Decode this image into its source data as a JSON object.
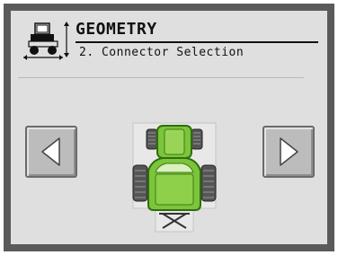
{
  "header": {
    "title": "GEOMETRY",
    "subtitle": "2. Connector Selection",
    "icon": "tractor-geometry-icon"
  },
  "nav": {
    "left_icon": "arrow-left-icon",
    "right_icon": "arrow-right-icon"
  },
  "machine": {
    "icon": "tractor-top-view-icon",
    "connector_icon": "hitch-connector-icon"
  },
  "colors": {
    "background": "#dfdfdf",
    "frame": "#5a5a5a",
    "tractor_green": "#7cc43a",
    "tractor_dark_green": "#2f6d0f",
    "button": "#bcbcbc"
  }
}
